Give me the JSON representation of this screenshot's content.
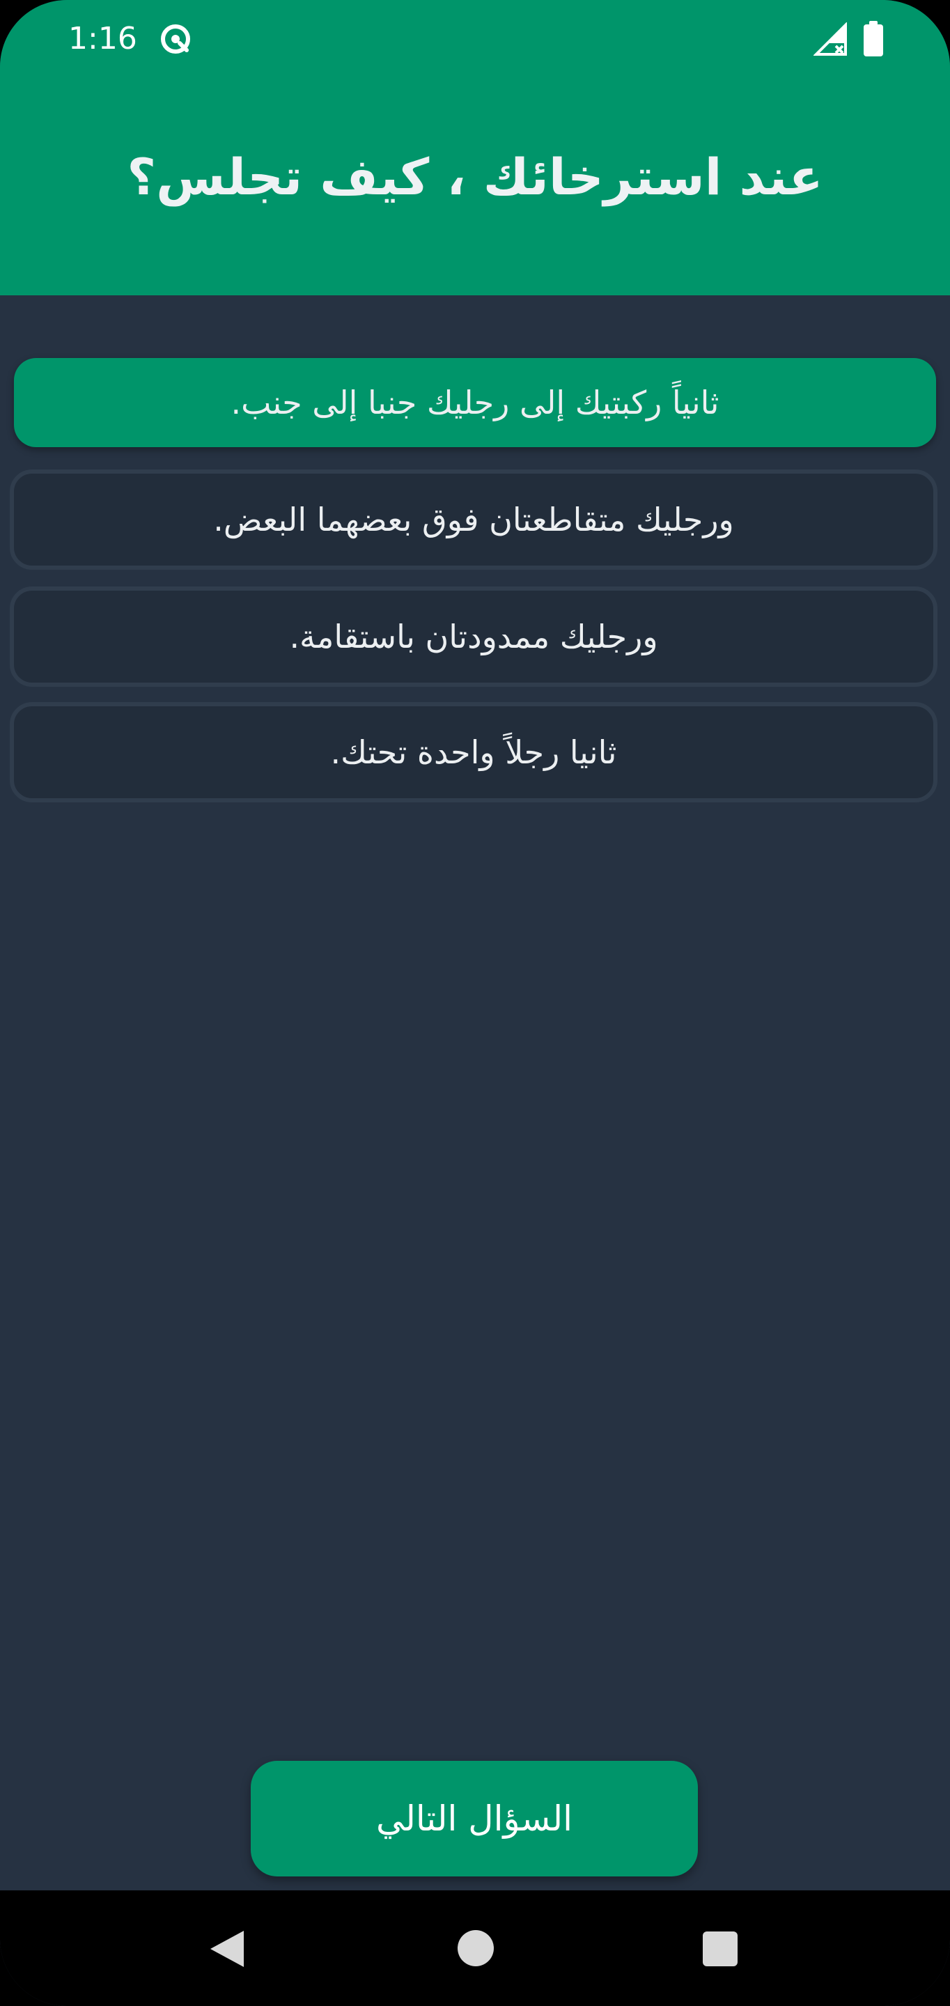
{
  "status_bar": {
    "time": "1:16",
    "icons": [
      "app-notification-icon",
      "signal-no-data-icon",
      "battery-full-icon"
    ]
  },
  "header": {
    "title": "عند استرخائك ، كيف تجلس؟"
  },
  "options": [
    {
      "label": "ثانياً ركبتيك إلى رجليك جنبا إلى جنب.",
      "selected": true
    },
    {
      "label": "ورجليك متقاطعتان فوق بعضهما البعض.",
      "selected": false
    },
    {
      "label": "ورجليك ممدودتان باستقامة.",
      "selected": false
    },
    {
      "label": "ثانيا رجلاً واحدة تحتك.",
      "selected": false
    }
  ],
  "next_button": {
    "label": "السؤال التالي"
  },
  "nav_bar": {
    "icons": [
      "back-icon",
      "home-icon",
      "recents-icon"
    ]
  },
  "colors": {
    "accent_green": "#00956A",
    "background": "#263242",
    "option_background": "#222D3B",
    "option_border": "#303D4D",
    "text_light": "#ECEFF1"
  }
}
